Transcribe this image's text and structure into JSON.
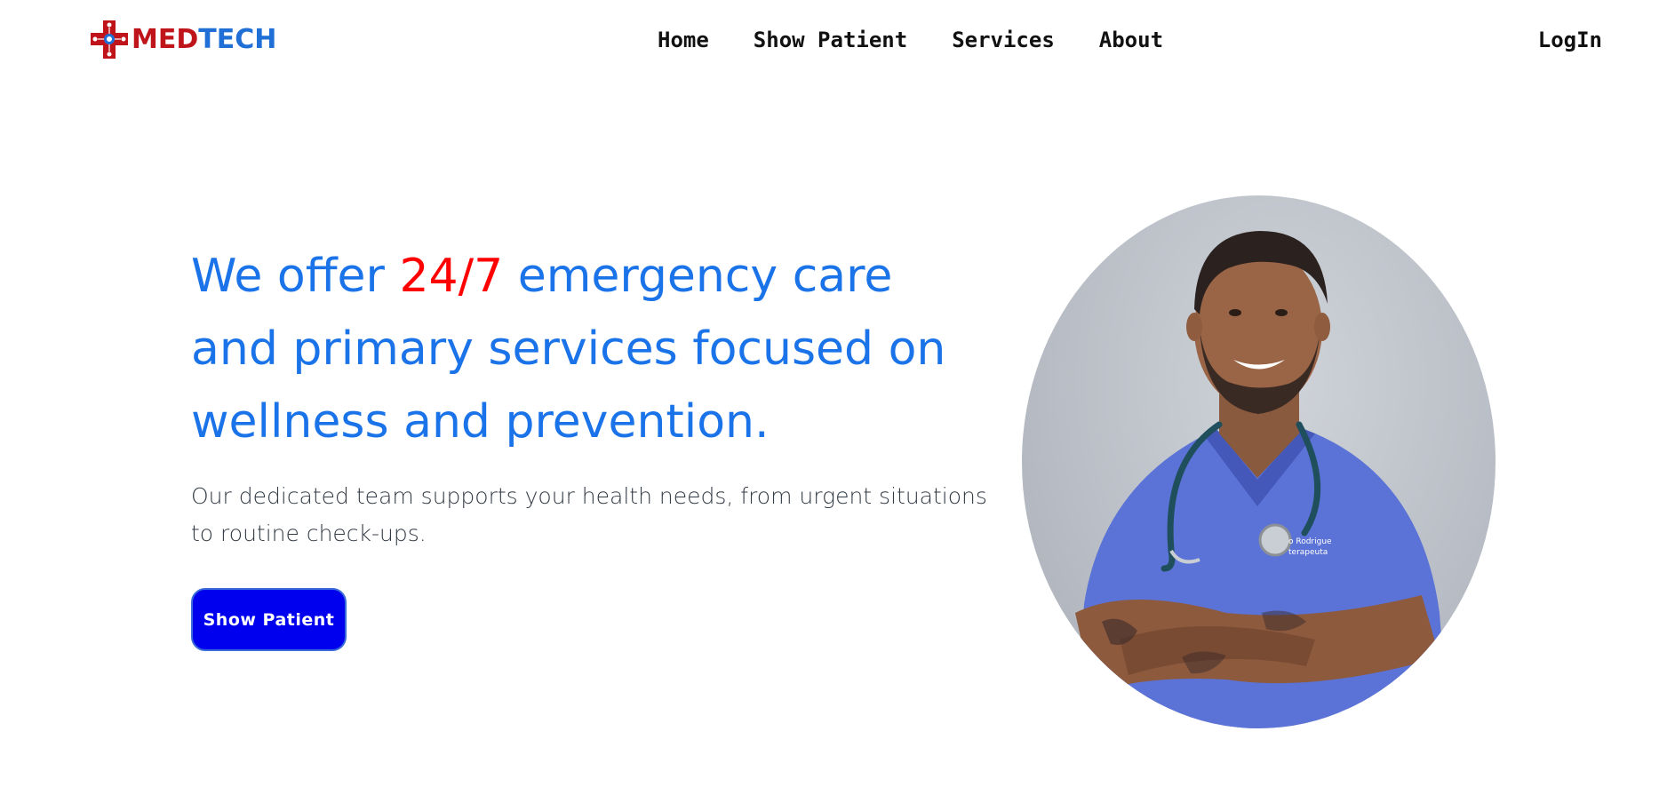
{
  "header": {
    "logo": {
      "med": "MED",
      "tech": "TECH"
    },
    "nav": [
      {
        "label": "Home"
      },
      {
        "label": "Show Patient"
      },
      {
        "label": "Services"
      },
      {
        "label": "About"
      }
    ],
    "login_label": "LogIn"
  },
  "hero": {
    "headline_before": "We offer ",
    "headline_accent": "24/7",
    "headline_after": " emergency care and primary services focused on wellness and prevention.",
    "subtext": "Our dedicated team supports your health needs, from urgent situations to routine check-ups.",
    "cta_label": "Show Patient"
  },
  "portrait": {
    "badge_line1": "o Rodrigue",
    "badge_line2": "terapeuta"
  },
  "colors": {
    "headline": "#1a73e8",
    "accent": "#ff0000",
    "cta_bg": "#0000ee",
    "logo_red": "#c0141b",
    "logo_blue": "#1f6fd6",
    "scrubs": "#5b73d6"
  },
  "icons": {
    "logo_mark": "medical-cross-circuit-icon"
  }
}
